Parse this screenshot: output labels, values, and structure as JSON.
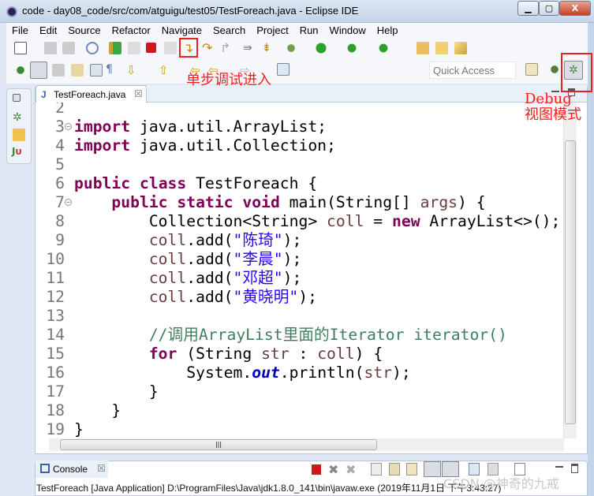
{
  "window": {
    "title": "code - day08_code/src/com/atguigu/test05/TestForeach.java - Eclipse IDE",
    "minimize": "▁",
    "restore": "▢",
    "close": "X"
  },
  "menu": [
    "File",
    "Edit",
    "Source",
    "Refactor",
    "Navigate",
    "Search",
    "Project",
    "Run",
    "Window",
    "Help"
  ],
  "toolbar": {
    "quick_access_placeholder": "Quick Access"
  },
  "editor": {
    "tab_label": "TestForeach.java",
    "tab_close": "☒",
    "lines": [
      {
        "n": "2",
        "tokens": []
      },
      {
        "n": "3",
        "fold": true,
        "tokens": [
          {
            "t": "import",
            "c": "k"
          },
          {
            "t": " java.util.ArrayList;"
          }
        ]
      },
      {
        "n": "4",
        "tokens": [
          {
            "t": "import",
            "c": "k"
          },
          {
            "t": " java.util.Collection;"
          }
        ]
      },
      {
        "n": "5",
        "tokens": []
      },
      {
        "n": "6",
        "tokens": [
          {
            "t": "public",
            "c": "k"
          },
          {
            "t": " "
          },
          {
            "t": "class",
            "c": "k"
          },
          {
            "t": " TestForeach {"
          }
        ]
      },
      {
        "n": "7",
        "fold": true,
        "tokens": [
          {
            "t": "    "
          },
          {
            "t": "public",
            "c": "k"
          },
          {
            "t": " "
          },
          {
            "t": "static",
            "c": "k"
          },
          {
            "t": " "
          },
          {
            "t": "void",
            "c": "k"
          },
          {
            "t": " main(String[] "
          },
          {
            "t": "args",
            "c": "v"
          },
          {
            "t": ") {"
          }
        ]
      },
      {
        "n": "8",
        "tokens": [
          {
            "t": "        Collection<String> "
          },
          {
            "t": "coll",
            "c": "v"
          },
          {
            "t": " = "
          },
          {
            "t": "new",
            "c": "k"
          },
          {
            "t": " ArrayList<>();"
          }
        ]
      },
      {
        "n": "9",
        "tokens": [
          {
            "t": "        "
          },
          {
            "t": "coll",
            "c": "v"
          },
          {
            "t": ".add("
          },
          {
            "t": "\"陈琦\"",
            "c": "s"
          },
          {
            "t": ");"
          }
        ]
      },
      {
        "n": "10",
        "tokens": [
          {
            "t": "        "
          },
          {
            "t": "coll",
            "c": "v"
          },
          {
            "t": ".add("
          },
          {
            "t": "\"李晨\"",
            "c": "s"
          },
          {
            "t": ");"
          }
        ]
      },
      {
        "n": "11",
        "tokens": [
          {
            "t": "        "
          },
          {
            "t": "coll",
            "c": "v"
          },
          {
            "t": ".add("
          },
          {
            "t": "\"邓超\"",
            "c": "s"
          },
          {
            "t": ");"
          }
        ]
      },
      {
        "n": "12",
        "tokens": [
          {
            "t": "        "
          },
          {
            "t": "coll",
            "c": "v"
          },
          {
            "t": ".add("
          },
          {
            "t": "\"黄晓明\"",
            "c": "s"
          },
          {
            "t": ");"
          }
        ]
      },
      {
        "n": "13",
        "tokens": []
      },
      {
        "n": "14",
        "tokens": [
          {
            "t": "        "
          },
          {
            "t": "//调用ArrayList里面的Iterator iterator()",
            "c": "c"
          }
        ]
      },
      {
        "n": "15",
        "current": true,
        "tokens": [
          {
            "t": "        "
          },
          {
            "t": "for",
            "c": "k"
          },
          {
            "t": " (String "
          },
          {
            "t": "str",
            "c": "v"
          },
          {
            "t": " : "
          },
          {
            "t": "coll",
            "c": "v"
          },
          {
            "t": ") {"
          }
        ]
      },
      {
        "n": "16",
        "tokens": [
          {
            "t": "            System."
          },
          {
            "t": "out",
            "c": "f"
          },
          {
            "t": ".println("
          },
          {
            "t": "str",
            "c": "v"
          },
          {
            "t": ");"
          }
        ]
      },
      {
        "n": "17",
        "tokens": [
          {
            "t": "        }"
          }
        ]
      },
      {
        "n": "18",
        "tokens": [
          {
            "t": "    }"
          }
        ]
      },
      {
        "n": "19",
        "tokens": [
          {
            "t": "}"
          }
        ]
      }
    ]
  },
  "console": {
    "tab_label": "Console",
    "tab_close": "☒",
    "text": "TestForeach [Java Application] D:\\ProgramFiles\\Java\\jdk1.8.0_141\\bin\\javaw.exe (2019年11月1日 下午3:43:27)"
  },
  "annotations": {
    "step_into": "单步调试进入",
    "debug_line1": "Debug",
    "debug_line2": "视图模式",
    "color": "#e82020"
  },
  "watermark": "CSDN @神奇的九戒",
  "colors": {
    "keyword": "#7f0055",
    "string": "#2a00ff",
    "comment": "#3f7f5f",
    "variable": "#6a3e3e",
    "current_line": "#c7dfae"
  }
}
